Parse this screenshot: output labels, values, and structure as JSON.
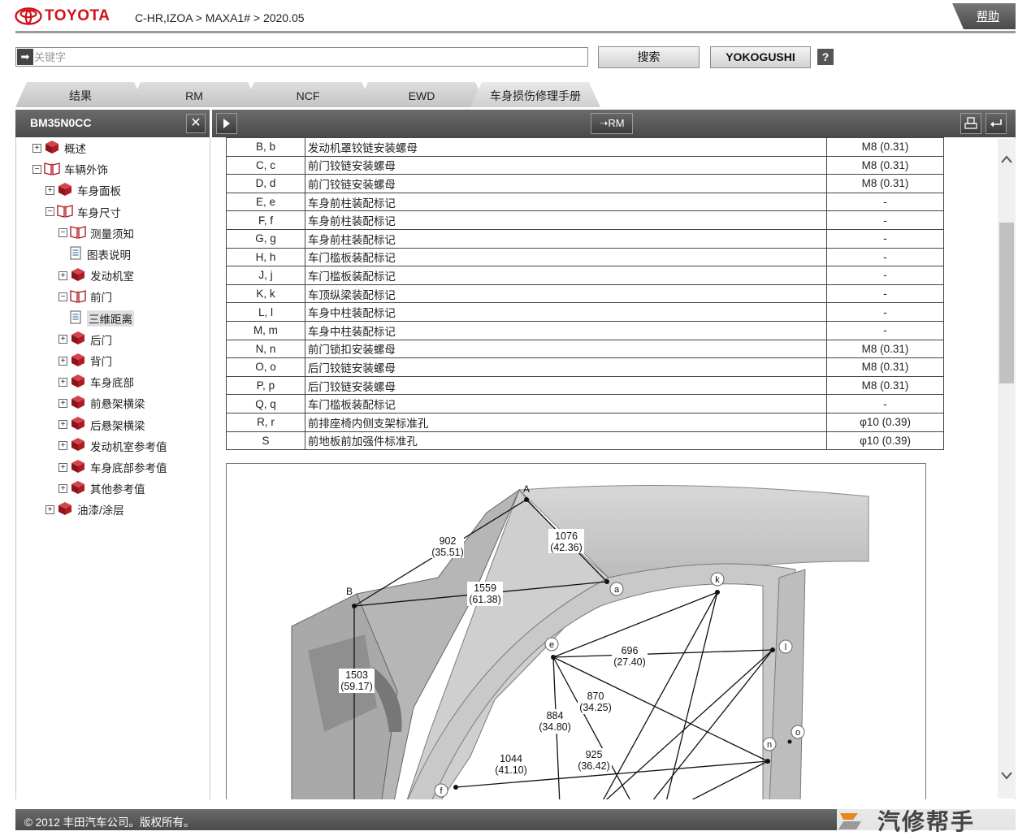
{
  "header": {
    "brand": "TOYOTA",
    "breadcrumb": "C-HR,IZOA > MAXA1# > 2020.05",
    "help_label": "帮助"
  },
  "search": {
    "placeholder": "关键字",
    "search_label": "搜索",
    "yokogushi_label": "YOKOGUSHI",
    "question_label": "?"
  },
  "tabs": [
    "结果",
    "RM",
    "NCF",
    "EWD",
    "车身损伤修理手册"
  ],
  "left_toolbar": {
    "doc_id": "BM35N0CC",
    "close_label": "✕"
  },
  "right_toolbar": {
    "rm_label": "RM"
  },
  "tree": [
    {
      "label": "概述",
      "toggle": "+",
      "icon": "book-closed-icon"
    },
    {
      "label": "车辆外饰",
      "toggle": "−",
      "icon": "book-open-icon"
    },
    {
      "label": "车身面板",
      "toggle": "+",
      "icon": "book-closed-icon"
    },
    {
      "label": "车身尺寸",
      "toggle": "−",
      "icon": "book-open-icon"
    },
    {
      "label": "测量须知",
      "toggle": "−",
      "icon": "book-open-icon"
    },
    {
      "label": "图表说明",
      "toggle": "",
      "icon": "page-icon"
    },
    {
      "label": "发动机室",
      "toggle": "+",
      "icon": "book-closed-icon"
    },
    {
      "label": "前门",
      "toggle": "−",
      "icon": "book-open-icon"
    },
    {
      "label": "三维距离",
      "toggle": "",
      "icon": "page-icon",
      "selected": true
    },
    {
      "label": "后门",
      "toggle": "+",
      "icon": "book-closed-icon"
    },
    {
      "label": "背门",
      "toggle": "+",
      "icon": "book-closed-icon"
    },
    {
      "label": "车身底部",
      "toggle": "+",
      "icon": "book-closed-icon"
    },
    {
      "label": "前悬架横梁",
      "toggle": "+",
      "icon": "book-closed-icon"
    },
    {
      "label": "后悬架横梁",
      "toggle": "+",
      "icon": "book-closed-icon"
    },
    {
      "label": "发动机室参考值",
      "toggle": "+",
      "icon": "book-closed-icon"
    },
    {
      "label": "车身底部参考值",
      "toggle": "+",
      "icon": "book-closed-icon"
    },
    {
      "label": "其他参考值",
      "toggle": "+",
      "icon": "book-closed-icon"
    },
    {
      "label": "油漆/涂层",
      "toggle": "+",
      "icon": "book-closed-icon"
    }
  ],
  "table": [
    [
      "B, b",
      "发动机罩铰链安装螺母",
      "M8 (0.31)"
    ],
    [
      "C, c",
      "前门铰链安装螺母",
      "M8 (0.31)"
    ],
    [
      "D, d",
      "前门铰链安装螺母",
      "M8 (0.31)"
    ],
    [
      "E, e",
      "车身前柱装配标记",
      "-"
    ],
    [
      "F, f",
      "车身前柱装配标记",
      "-"
    ],
    [
      "G, g",
      "车身前柱装配标记",
      "-"
    ],
    [
      "H, h",
      "车门槛板装配标记",
      "-"
    ],
    [
      "J, j",
      "车门槛板装配标记",
      "-"
    ],
    [
      "K, k",
      "车顶纵梁装配标记",
      "-"
    ],
    [
      "L, l",
      "车身中柱装配标记",
      "-"
    ],
    [
      "M, m",
      "车身中柱装配标记",
      "-"
    ],
    [
      "N, n",
      "前门锁扣安装螺母",
      "M8 (0.31)"
    ],
    [
      "O, o",
      "后门铰链安装螺母",
      "M8 (0.31)"
    ],
    [
      "P, p",
      "后门铰链安装螺母",
      "M8 (0.31)"
    ],
    [
      "Q, q",
      "车门槛板装配标记",
      "-"
    ],
    [
      "R, r",
      "前排座椅内侧支架标准孔",
      "φ10 (0.39)"
    ],
    [
      "S",
      "前地板前加强件标准孔",
      "φ10 (0.39)"
    ]
  ],
  "diagram": {
    "points": [
      "A",
      "B",
      "a",
      "k",
      "e",
      "l",
      "f",
      "n",
      "o"
    ],
    "dims": [
      {
        "mm": "902",
        "in": "(35.51)"
      },
      {
        "mm": "1076",
        "in": "(42.36)"
      },
      {
        "mm": "1559",
        "in": "(61.38)"
      },
      {
        "mm": "1503",
        "in": "(59.17)"
      },
      {
        "mm": "696",
        "in": "(27.40)"
      },
      {
        "mm": "870",
        "in": "(34.25)"
      },
      {
        "mm": "884",
        "in": "(34.80)"
      },
      {
        "mm": "925",
        "in": "(36.42)"
      },
      {
        "mm": "1044",
        "in": "(41.10)"
      }
    ]
  },
  "footer": {
    "copyright": "© 2012 丰田汽车公司。版权所有。"
  },
  "watermark": "汽修帮手",
  "colors": {
    "brand_red": "#d0111b",
    "toolbar_dark": "#4a4a4a",
    "book_red": "#b01c24"
  }
}
